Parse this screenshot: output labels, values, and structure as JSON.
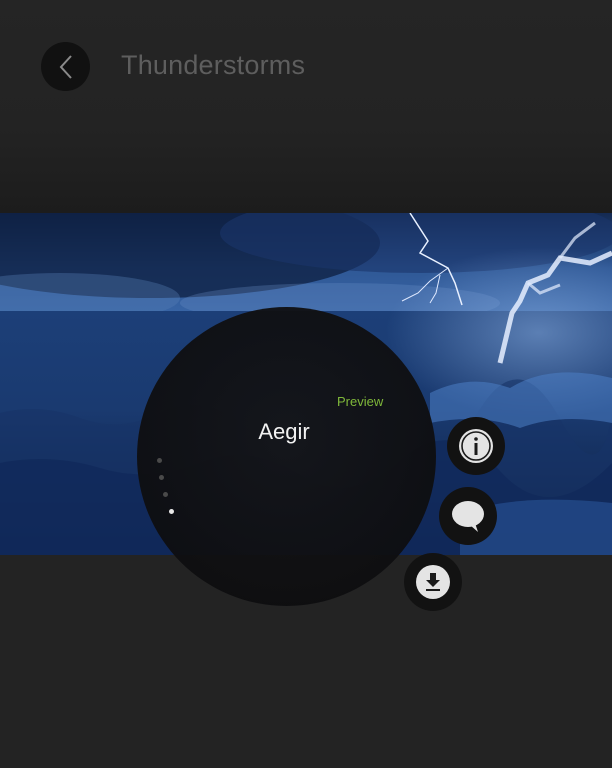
{
  "header": {
    "back_icon": "chevron-left-icon",
    "title": "Thunderstorms"
  },
  "theme": {
    "name": "Aegir",
    "preview_label": "Preview",
    "image": "stormy sea with lightning"
  },
  "pager": {
    "count": 4,
    "active_index": 3
  },
  "actions": [
    {
      "icon": "info-icon"
    },
    {
      "icon": "comment-icon"
    },
    {
      "icon": "download-icon"
    }
  ],
  "colors": {
    "background": "#232323",
    "accent_preview": "#7fb83a",
    "title_text": "#5e5e5e",
    "button_bg": "#121212"
  }
}
